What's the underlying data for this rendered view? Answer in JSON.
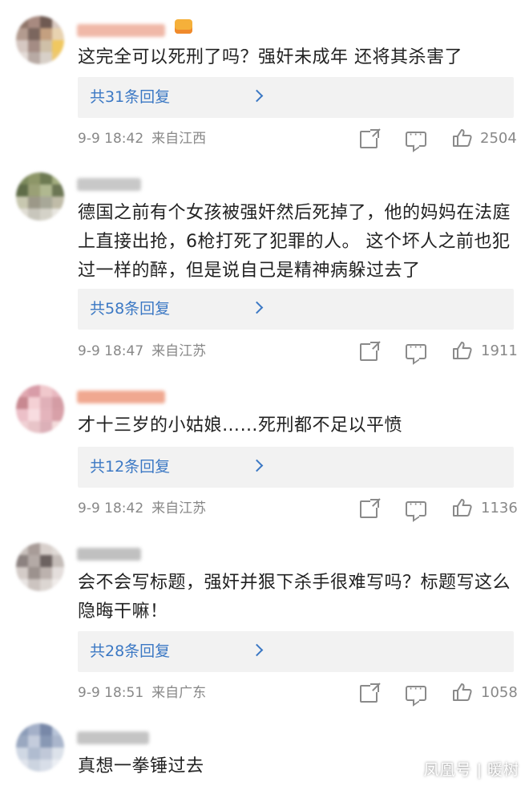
{
  "comments": [
    {
      "text": "这完全可以死刑了吗？强奸未成年 还将其杀害了",
      "replies": "共31条回复",
      "time": "9-9 18:42",
      "region": "来自江西",
      "likes": "2504",
      "avatar_colors": [
        "#8e7468",
        "#a88a80",
        "#6f5a52",
        "#d8c8c0",
        "#b39b8f",
        "#7b665e",
        "#c4a080",
        "#e8d2b0",
        "#d6c8c2",
        "#a48c84",
        "#cfc0a8",
        "#f0c860",
        "#e4dcd8",
        "#b8aaa4",
        "#d8d0c8",
        "#eec870"
      ],
      "username_color": "#f0b8a8"
    },
    {
      "text": "德国之前有个女孩被强奸然后死掉了，他的妈妈在法庭上直接出抢，6枪打死了犯罪的人。 这个坏人之前也犯过一样的醉，但是说自己是精神病躲过去了",
      "replies": "共58条回复",
      "time": "9-9 18:47",
      "region": "来自江苏",
      "likes": "1911",
      "avatar_colors": [
        "#7c8a5c",
        "#8d9668",
        "#6d7a52",
        "#a4ae80",
        "#5f6c48",
        "#9aa076",
        "#b0b890",
        "#6c7654",
        "#c8c8b0",
        "#9c9888",
        "#a8a898",
        "#c0bca8",
        "#e0ddd4",
        "#c8c6bc",
        "#d4d2c8",
        "#e8e6e0"
      ],
      "username_color": "#c8c8c8"
    },
    {
      "text": "才十三岁的小姑娘……死刑都不足以平愤",
      "replies": "共12条回复",
      "time": "9-9 18:42",
      "region": "来自江苏",
      "likes": "1136",
      "avatar_colors": [
        "#e0a8b0",
        "#d89ca8",
        "#f0c8cc",
        "#e8b8c0",
        "#c88890",
        "#f4d0d4",
        "#e0b0b8",
        "#d49ca4",
        "#ecc0c8",
        "#f8dce0",
        "#e4b4bc",
        "#d8a0a8",
        "#f0d0d4",
        "#e8c4c8",
        "#dcb0b8",
        "#f4dcdc"
      ],
      "username_color": "#f0a890"
    },
    {
      "text": "会不会写标题，强奸并狠下杀手很难写吗？标题写这么隐晦干嘛！",
      "replies": "共28条回复",
      "time": "9-9 18:51",
      "region": "来自广东",
      "likes": "1058",
      "avatar_colors": [
        "#c8c0bc",
        "#a89c98",
        "#d8d0cc",
        "#e0dad6",
        "#8c8280",
        "#b4aaa6",
        "#6c6260",
        "#c4bcb8",
        "#d4ccc8",
        "#9c928e",
        "#bcb2ae",
        "#e4dedc",
        "#e8e4e2",
        "#ccc4c0",
        "#dcd6d2",
        "#f0ecea"
      ],
      "username_color": "#c0c0c0"
    },
    {
      "text": "真想一拳锤过去",
      "avatar_colors": [
        "#8c9cb8",
        "#a4b0c8",
        "#7888a8",
        "#b8c4d8",
        "#9aa8c0",
        "#c4ccdc",
        "#8898b4",
        "#aab6cc",
        "#d0d8e4",
        "#b0bcd0",
        "#c0c8d8",
        "#dce2ea",
        "#e0e4ec",
        "#ccd4e0",
        "#d8dee8",
        "#eceff4"
      ],
      "username_color": "#c4c4c4"
    }
  ],
  "icons": {
    "share": "share-icon",
    "comment": "comment-icon",
    "like": "thumbs-up-icon",
    "chevron": "chevron-right-icon",
    "crown": "crown-icon"
  },
  "watermark": {
    "left": "凤凰号",
    "separator": "|",
    "right": "暖树"
  },
  "colors": {
    "reply_link": "#3b78c4",
    "reply_box": "#f2f2f2",
    "meta_text": "#888888"
  }
}
